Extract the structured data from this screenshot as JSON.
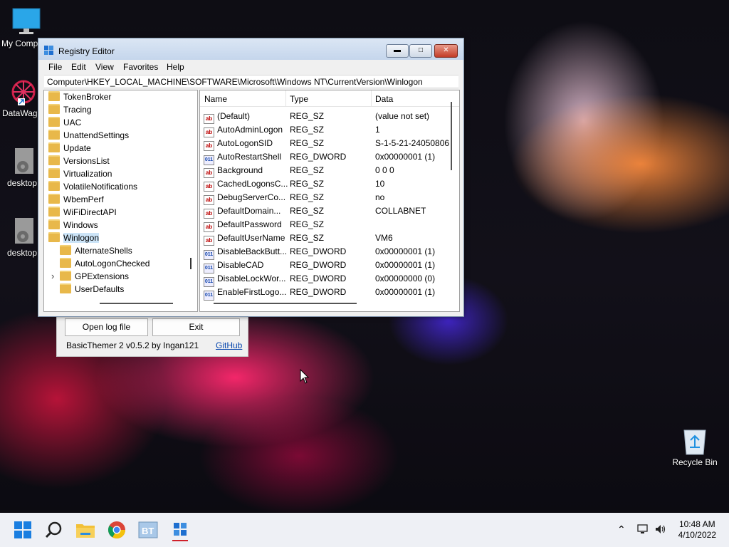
{
  "desktop": {
    "icons": [
      {
        "label": "My Comp",
        "icon": "monitor-icon"
      },
      {
        "label": "DataWag",
        "icon": "datawag-icon"
      },
      {
        "label": "desktop",
        "icon": "gear-file-icon"
      },
      {
        "label": "desktop",
        "icon": "gear-file-icon"
      }
    ],
    "recycle_bin": "Recycle Bin"
  },
  "window": {
    "title": "Registry Editor",
    "menu": [
      "File",
      "Edit",
      "View",
      "Favorites",
      "Help"
    ],
    "address": "Computer\\HKEY_LOCAL_MACHINE\\SOFTWARE\\Microsoft\\Windows NT\\CurrentVersion\\Winlogon",
    "tree": [
      {
        "label": "TokenBroker",
        "indent": 0
      },
      {
        "label": "Tracing",
        "indent": 0
      },
      {
        "label": "UAC",
        "indent": 0
      },
      {
        "label": "UnattendSettings",
        "indent": 0
      },
      {
        "label": "Update",
        "indent": 0
      },
      {
        "label": "VersionsList",
        "indent": 0
      },
      {
        "label": "Virtualization",
        "indent": 0
      },
      {
        "label": "VolatileNotifications",
        "indent": 0
      },
      {
        "label": "WbemPerf",
        "indent": 0
      },
      {
        "label": "WiFiDirectAPI",
        "indent": 0
      },
      {
        "label": "Windows",
        "indent": 0
      },
      {
        "label": "Winlogon",
        "indent": 0,
        "selected": true
      },
      {
        "label": "AlternateShells",
        "indent": 1
      },
      {
        "label": "AutoLogonChecked",
        "indent": 1
      },
      {
        "label": "GPExtensions",
        "indent": 1,
        "expander": true
      },
      {
        "label": "UserDefaults",
        "indent": 1
      }
    ],
    "columns": [
      "Name",
      "Type",
      "Data"
    ],
    "values": [
      {
        "name": "(Default)",
        "type": "REG_SZ",
        "data": "(value not set)",
        "kind": "ab"
      },
      {
        "name": "AutoAdminLogon",
        "type": "REG_SZ",
        "data": "1",
        "kind": "ab"
      },
      {
        "name": "AutoLogonSID",
        "type": "REG_SZ",
        "data": "S-1-5-21-24050806",
        "kind": "ab"
      },
      {
        "name": "AutoRestartShell",
        "type": "REG_DWORD",
        "data": "0x00000001 (1)",
        "kind": "dw"
      },
      {
        "name": "Background",
        "type": "REG_SZ",
        "data": "0 0 0",
        "kind": "ab"
      },
      {
        "name": "CachedLogonsC...",
        "type": "REG_SZ",
        "data": "10",
        "kind": "ab"
      },
      {
        "name": "DebugServerCo...",
        "type": "REG_SZ",
        "data": "no",
        "kind": "ab"
      },
      {
        "name": "DefaultDomain...",
        "type": "REG_SZ",
        "data": "COLLABNET",
        "kind": "ab"
      },
      {
        "name": "DefaultPassword",
        "type": "REG_SZ",
        "data": "",
        "kind": "ab"
      },
      {
        "name": "DefaultUserName",
        "type": "REG_SZ",
        "data": "VM6",
        "kind": "ab"
      },
      {
        "name": "DisableBackButt...",
        "type": "REG_DWORD",
        "data": "0x00000001 (1)",
        "kind": "dw"
      },
      {
        "name": "DisableCAD",
        "type": "REG_DWORD",
        "data": "0x00000001 (1)",
        "kind": "dw"
      },
      {
        "name": "DisableLockWor...",
        "type": "REG_DWORD",
        "data": "0x00000000 (0)",
        "kind": "dw"
      },
      {
        "name": "EnableFirstLogo...",
        "type": "REG_DWORD",
        "data": "0x00000001 (1)",
        "kind": "dw"
      }
    ]
  },
  "basicthemer": {
    "open_log": "Open log file",
    "exit": "Exit",
    "info": "BasicThemer 2 v0.5.2 by Ingan121",
    "link": "GitHub"
  },
  "taskbar": {
    "icons": [
      "windows-start-icon",
      "search-icon",
      "file-explorer-icon",
      "chrome-icon",
      "basicthemer-icon",
      "registry-editor-icon"
    ],
    "time": "10:48 AM",
    "date": "4/10/2022"
  }
}
